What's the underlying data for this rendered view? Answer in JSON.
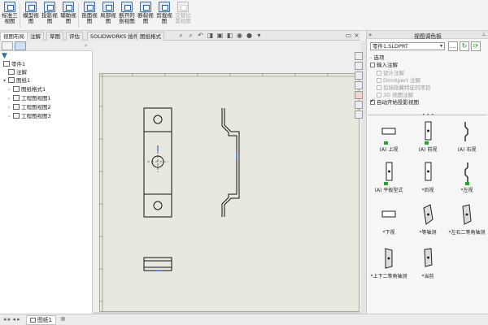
{
  "ribbon": {
    "buttons": [
      {
        "label": "标准三视图",
        "enabled": true
      },
      {
        "label": "模型视图",
        "enabled": true
      },
      {
        "label": "投影视图",
        "enabled": true
      },
      {
        "label": "辅助视图",
        "enabled": true
      },
      {
        "label": "剖面视图",
        "enabled": true
      },
      {
        "label": "局部视图",
        "enabled": true
      },
      {
        "label": "断开的剖视图",
        "enabled": true
      },
      {
        "label": "断裂视图",
        "enabled": true
      },
      {
        "label": "剪裁视图",
        "enabled": true
      },
      {
        "label": "交替位置视图",
        "enabled": false
      }
    ]
  },
  "tabs": [
    "视图布局",
    "注解",
    "草图",
    "评估",
    "SOLIDWORKS 插件",
    "图纸格式"
  ],
  "active_tab": "视图布局",
  "feature_tree": {
    "root": "零件1",
    "items": [
      {
        "label": "注解",
        "level": 1
      },
      {
        "label": "图纸1",
        "level": 1
      },
      {
        "label": "图纸格式1",
        "level": 2
      },
      {
        "label": "工程图视图1",
        "level": 2
      },
      {
        "label": "工程图视图2",
        "level": 2
      },
      {
        "label": "工程图视图3",
        "level": 2
      }
    ]
  },
  "view_palette": {
    "title": "视图调色板",
    "file_select": "零件1.SLDPRT",
    "options_label": "选项",
    "import_annotations_label": "输入注解",
    "import_annotations_checked": false,
    "sub_options": [
      {
        "label": "设计注解",
        "enabled": false
      },
      {
        "label": "DimXpert 注解",
        "enabled": false
      },
      {
        "label": "包括隐藏特征的项目",
        "enabled": false
      },
      {
        "label": "3D 视图注解",
        "enabled": false
      }
    ],
    "auto_projection_label": "自动开始投影视图",
    "auto_projection_checked": true,
    "views": [
      {
        "label": "(A) 上视"
      },
      {
        "label": "(A) 前视"
      },
      {
        "label": "(A) 右视"
      },
      {
        "label": "(A) 平板型式"
      },
      {
        "label": "*后视"
      },
      {
        "label": "*左视"
      },
      {
        "label": "*下视"
      },
      {
        "label": "*等轴测"
      },
      {
        "label": "*左右二等角轴测"
      },
      {
        "label": "*上下二等角轴测"
      },
      {
        "label": "*当前"
      }
    ]
  },
  "status": {
    "sheet_tab": "图纸1"
  }
}
